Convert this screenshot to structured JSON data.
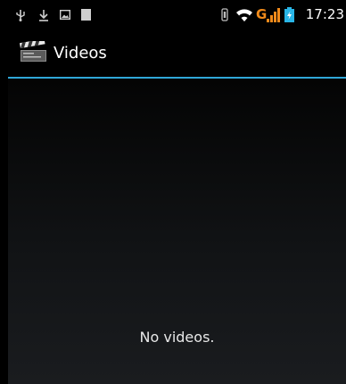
{
  "status_bar": {
    "time": "17:23",
    "icons": {
      "usb": "usb-icon",
      "download": "download-icon",
      "gallery": "image-notification-icon",
      "notification": "notification-icon",
      "vibrate": "vibrate-icon",
      "wifi": "wifi-icon",
      "network": "G",
      "signal": "signal-icon",
      "battery": "battery-icon"
    }
  },
  "action_bar": {
    "title": "Videos",
    "icon": "clapperboard-icon"
  },
  "main": {
    "empty_message": "No videos."
  },
  "colors": {
    "accent": "#2fa7d8",
    "network_g": "#f08a1a",
    "battery": "#29b6e8"
  }
}
